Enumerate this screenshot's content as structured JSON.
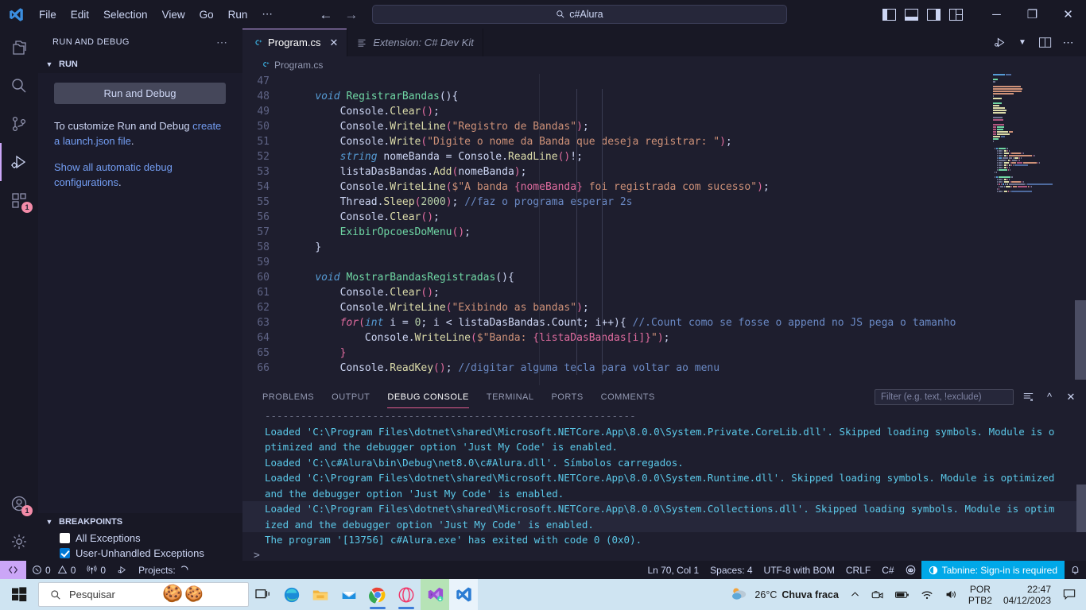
{
  "titlebar": {
    "menus": [
      "File",
      "Edit",
      "Selection",
      "View",
      "Go",
      "Run",
      "⋯"
    ],
    "search_value": "c#Alura",
    "back_icon": "arrow-left-icon",
    "forward_icon": "arrow-right-icon",
    "minimize": "─",
    "maximize": "❐",
    "close": "✕"
  },
  "activitybar": {
    "items": [
      {
        "name": "explorer",
        "badge": ""
      },
      {
        "name": "search",
        "badge": ""
      },
      {
        "name": "source-control",
        "badge": ""
      },
      {
        "name": "run-and-debug",
        "badge": ""
      },
      {
        "name": "extensions",
        "badge": "1"
      }
    ],
    "bottom": [
      {
        "name": "accounts",
        "badge": "1"
      },
      {
        "name": "manage-settings",
        "badge": ""
      }
    ]
  },
  "sidebar": {
    "title": "RUN AND DEBUG",
    "more_actions": "⋯",
    "run_section": {
      "label": "RUN",
      "button_label": "Run and Debug",
      "hint_prefix": "To customize Run and Debug ",
      "hint_link": "create a launch.json file",
      "hint_suffix": ".",
      "link2": "Show all automatic debug configurations",
      "link2_suffix": "."
    },
    "breakpoints": {
      "label": "BREAKPOINTS",
      "items": [
        {
          "label": "All Exceptions",
          "checked": false
        },
        {
          "label": "User-Unhandled Exceptions",
          "checked": true
        }
      ]
    }
  },
  "editor": {
    "tabs": [
      {
        "label": "Program.cs",
        "icon": "csharp-icon",
        "active": true,
        "italic": false,
        "close": "✕"
      },
      {
        "label": "Extension: C# Dev Kit",
        "icon": "extension-icon",
        "active": false,
        "italic": true,
        "close": ""
      }
    ],
    "toolbar": [
      "run-debug-icon",
      "chevron-down-icon",
      "split-editor-icon",
      "more-actions-icon"
    ],
    "breadcrumb": "Program.cs",
    "first_line_number": 47,
    "lines": [
      {
        "n": 47,
        "tokens": []
      },
      {
        "n": 48,
        "tokens": [
          {
            "t": "    ",
            "c": "c-plain"
          },
          {
            "t": "void ",
            "c": "c-kw"
          },
          {
            "t": "RegistrarBandas",
            "c": "c-fn"
          },
          {
            "t": "(){",
            "c": "c-plain"
          }
        ]
      },
      {
        "n": 49,
        "tokens": [
          {
            "t": "        ",
            "c": "c-plain"
          },
          {
            "t": "Console",
            "c": "c-plain"
          },
          {
            "t": ".",
            "c": "c-plain"
          },
          {
            "t": "Clear",
            "c": "c-meth"
          },
          {
            "t": "()",
            "c": "c-pun"
          },
          {
            "t": ";",
            "c": "c-plain"
          }
        ]
      },
      {
        "n": 50,
        "tokens": [
          {
            "t": "        ",
            "c": "c-plain"
          },
          {
            "t": "Console",
            "c": "c-plain"
          },
          {
            "t": ".",
            "c": "c-plain"
          },
          {
            "t": "WriteLine",
            "c": "c-meth"
          },
          {
            "t": "(",
            "c": "c-pun"
          },
          {
            "t": "\"Registro de Bandas\"",
            "c": "c-str"
          },
          {
            "t": ")",
            "c": "c-pun"
          },
          {
            "t": ";",
            "c": "c-plain"
          }
        ]
      },
      {
        "n": 51,
        "tokens": [
          {
            "t": "        ",
            "c": "c-plain"
          },
          {
            "t": "Console",
            "c": "c-plain"
          },
          {
            "t": ".",
            "c": "c-plain"
          },
          {
            "t": "Write",
            "c": "c-meth"
          },
          {
            "t": "(",
            "c": "c-pun"
          },
          {
            "t": "\"Digite o nome da Banda que deseja registrar: \"",
            "c": "c-str"
          },
          {
            "t": ")",
            "c": "c-pun"
          },
          {
            "t": ";",
            "c": "c-plain"
          }
        ]
      },
      {
        "n": 52,
        "tokens": [
          {
            "t": "        ",
            "c": "c-plain"
          },
          {
            "t": "string",
            "c": "c-kw"
          },
          {
            "t": " nomeBanda = ",
            "c": "c-plain"
          },
          {
            "t": "Console",
            "c": "c-plain"
          },
          {
            "t": ".",
            "c": "c-plain"
          },
          {
            "t": "ReadLine",
            "c": "c-meth"
          },
          {
            "t": "()",
            "c": "c-pun"
          },
          {
            "t": "!;",
            "c": "c-plain"
          }
        ]
      },
      {
        "n": 53,
        "tokens": [
          {
            "t": "        ",
            "c": "c-plain"
          },
          {
            "t": "listaDasBandas",
            "c": "c-plain"
          },
          {
            "t": ".",
            "c": "c-plain"
          },
          {
            "t": "Add",
            "c": "c-meth"
          },
          {
            "t": "(",
            "c": "c-pun"
          },
          {
            "t": "nomeBanda",
            "c": "c-plain"
          },
          {
            "t": ")",
            "c": "c-pun"
          },
          {
            "t": ";",
            "c": "c-plain"
          }
        ]
      },
      {
        "n": 54,
        "tokens": [
          {
            "t": "        ",
            "c": "c-plain"
          },
          {
            "t": "Console",
            "c": "c-plain"
          },
          {
            "t": ".",
            "c": "c-plain"
          },
          {
            "t": "WriteLine",
            "c": "c-meth"
          },
          {
            "t": "(",
            "c": "c-pun"
          },
          {
            "t": "$\"A banda ",
            "c": "c-str"
          },
          {
            "t": "{nomeBanda}",
            "c": "c-interp"
          },
          {
            "t": " foi registrada com sucesso\"",
            "c": "c-str"
          },
          {
            "t": ")",
            "c": "c-pun"
          },
          {
            "t": ";",
            "c": "c-plain"
          }
        ]
      },
      {
        "n": 55,
        "tokens": [
          {
            "t": "        ",
            "c": "c-plain"
          },
          {
            "t": "Thread",
            "c": "c-plain"
          },
          {
            "t": ".",
            "c": "c-plain"
          },
          {
            "t": "Sleep",
            "c": "c-meth"
          },
          {
            "t": "(",
            "c": "c-pun"
          },
          {
            "t": "2000",
            "c": "c-num"
          },
          {
            "t": ")",
            "c": "c-pun"
          },
          {
            "t": "; ",
            "c": "c-plain"
          },
          {
            "t": "//faz o programa esperar 2s",
            "c": "c-cmt"
          }
        ]
      },
      {
        "n": 56,
        "tokens": [
          {
            "t": "        ",
            "c": "c-plain"
          },
          {
            "t": "Console",
            "c": "c-plain"
          },
          {
            "t": ".",
            "c": "c-plain"
          },
          {
            "t": "Clear",
            "c": "c-meth"
          },
          {
            "t": "()",
            "c": "c-pun"
          },
          {
            "t": ";",
            "c": "c-plain"
          }
        ]
      },
      {
        "n": 57,
        "tokens": [
          {
            "t": "        ",
            "c": "c-plain"
          },
          {
            "t": "ExibirOpcoesDoMenu",
            "c": "c-fn"
          },
          {
            "t": "()",
            "c": "c-pun"
          },
          {
            "t": ";",
            "c": "c-plain"
          }
        ]
      },
      {
        "n": 58,
        "tokens": [
          {
            "t": "    ",
            "c": "c-plain"
          },
          {
            "t": "}",
            "c": "c-plain"
          }
        ]
      },
      {
        "n": 59,
        "tokens": []
      },
      {
        "n": 60,
        "tokens": [
          {
            "t": "    ",
            "c": "c-plain"
          },
          {
            "t": "void ",
            "c": "c-kw"
          },
          {
            "t": "MostrarBandasRegistradas",
            "c": "c-fn"
          },
          {
            "t": "(){",
            "c": "c-plain"
          }
        ]
      },
      {
        "n": 61,
        "tokens": [
          {
            "t": "        ",
            "c": "c-plain"
          },
          {
            "t": "Console",
            "c": "c-plain"
          },
          {
            "t": ".",
            "c": "c-plain"
          },
          {
            "t": "Clear",
            "c": "c-meth"
          },
          {
            "t": "()",
            "c": "c-pun"
          },
          {
            "t": ";",
            "c": "c-plain"
          }
        ]
      },
      {
        "n": 62,
        "tokens": [
          {
            "t": "        ",
            "c": "c-plain"
          },
          {
            "t": "Console",
            "c": "c-plain"
          },
          {
            "t": ".",
            "c": "c-plain"
          },
          {
            "t": "WriteLine",
            "c": "c-meth"
          },
          {
            "t": "(",
            "c": "c-pun"
          },
          {
            "t": "\"Exibindo as bandas\"",
            "c": "c-str"
          },
          {
            "t": ")",
            "c": "c-pun"
          },
          {
            "t": ";",
            "c": "c-plain"
          }
        ]
      },
      {
        "n": 63,
        "tokens": [
          {
            "t": "        ",
            "c": "c-plain"
          },
          {
            "t": "for",
            "c": "c-ctrl"
          },
          {
            "t": "(",
            "c": "c-pun"
          },
          {
            "t": "int",
            "c": "c-kw"
          },
          {
            "t": " i = ",
            "c": "c-plain"
          },
          {
            "t": "0",
            "c": "c-num"
          },
          {
            "t": "; i < listaDasBandas.Count; i++)",
            "c": "c-plain"
          },
          {
            "t": "{ ",
            "c": "c-plain"
          },
          {
            "t": "//.Count como se fosse o append no JS pega o tamanho",
            "c": "c-cmt"
          }
        ]
      },
      {
        "n": 64,
        "tokens": [
          {
            "t": "            ",
            "c": "c-plain"
          },
          {
            "t": "Console",
            "c": "c-plain"
          },
          {
            "t": ".",
            "c": "c-plain"
          },
          {
            "t": "WriteLine",
            "c": "c-meth"
          },
          {
            "t": "(",
            "c": "c-pun"
          },
          {
            "t": "$\"Banda: ",
            "c": "c-str"
          },
          {
            "t": "{listaDasBandas[i]}",
            "c": "c-interp"
          },
          {
            "t": "\"",
            "c": "c-str"
          },
          {
            "t": ")",
            "c": "c-pun"
          },
          {
            "t": ";",
            "c": "c-plain"
          }
        ]
      },
      {
        "n": 65,
        "tokens": [
          {
            "t": "        ",
            "c": "c-plain"
          },
          {
            "t": "}",
            "c": "c-pun"
          }
        ]
      },
      {
        "n": 66,
        "tokens": [
          {
            "t": "        ",
            "c": "c-plain"
          },
          {
            "t": "Console",
            "c": "c-plain"
          },
          {
            "t": ".",
            "c": "c-plain"
          },
          {
            "t": "ReadKey",
            "c": "c-meth"
          },
          {
            "t": "()",
            "c": "c-pun"
          },
          {
            "t": "; ",
            "c": "c-plain"
          },
          {
            "t": "//digitar alguma tecla para voltar ao menu",
            "c": "c-cmt"
          }
        ]
      }
    ]
  },
  "panel": {
    "tabs": [
      "PROBLEMS",
      "OUTPUT",
      "DEBUG CONSOLE",
      "TERMINAL",
      "PORTS",
      "COMMENTS"
    ],
    "active_tab": "DEBUG CONSOLE",
    "filter_placeholder": "Filter (e.g. text, !exclude)",
    "actions": [
      "clear-console-icon",
      "chevron-up-icon",
      "close-icon"
    ],
    "console_lines": [
      {
        "text": "--------------------------------------------------------------",
        "style": "dim",
        "highlight": false
      },
      {
        "text": "Loaded 'C:\\Program Files\\dotnet\\shared\\Microsoft.NETCore.App\\8.0.0\\System.Private.CoreLib.dll'. Skipped loading symbols. Module is o",
        "style": "",
        "highlight": false
      },
      {
        "text": "ptimized and the debugger option 'Just My Code' is enabled.",
        "style": "",
        "highlight": false
      },
      {
        "text": "Loaded 'C:\\c#Alura\\bin\\Debug\\net8.0\\c#Alura.dll'. Símbolos carregados.",
        "style": "",
        "highlight": false
      },
      {
        "text": "Loaded 'C:\\Program Files\\dotnet\\shared\\Microsoft.NETCore.App\\8.0.0\\System.Runtime.dll'. Skipped loading symbols. Module is optimized",
        "style": "",
        "highlight": false
      },
      {
        "text": "and the debugger option 'Just My Code' is enabled.",
        "style": "",
        "highlight": false
      },
      {
        "text": "Loaded 'C:\\Program Files\\dotnet\\shared\\Microsoft.NETCore.App\\8.0.0\\System.Collections.dll'. Skipped loading symbols. Module is optim",
        "style": "",
        "highlight": true
      },
      {
        "text": "ized and the debugger option 'Just My Code' is enabled.",
        "style": "",
        "highlight": true
      },
      {
        "text": "The program '[13756] c#Alura.exe' has exited with code 0 (0x0).",
        "style": "",
        "highlight": false
      }
    ],
    "prompt": ">"
  },
  "statusbar": {
    "remote_icon": "remote-window-icon",
    "errors": "0",
    "warnings": "0",
    "ports": "0",
    "debug_icon": "run-debug-icon",
    "projects_label": "Projects:",
    "projects_spinner": "loading-spinner",
    "position": "Ln 70, Col 1",
    "spaces": "Spaces: 4",
    "encoding": "UTF-8 with BOM",
    "eol": "CRLF",
    "language": "C#",
    "extra_icon": "copilot-icon",
    "tabnine": "Tabnine: Sign-in is required",
    "bell_icon": "notifications-icon"
  },
  "taskbar": {
    "start": "windows-start-icon",
    "search_placeholder": "Pesquisar",
    "search_icon": "search-icon",
    "decor_icons": [
      "gingerbread-icon",
      "cookie-icon"
    ],
    "apps": [
      {
        "name": "task-view-icon",
        "state": ""
      },
      {
        "name": "microsoft-edge-icon",
        "state": ""
      },
      {
        "name": "file-explorer-icon",
        "state": ""
      },
      {
        "name": "mail-icon",
        "state": ""
      },
      {
        "name": "google-chrome-icon",
        "state": "running"
      },
      {
        "name": "opera-icon",
        "state": "running"
      },
      {
        "name": "visual-studio-icon",
        "state": "active-green"
      },
      {
        "name": "vscode-icon",
        "state": "active-white"
      }
    ],
    "weather": {
      "temp": "26°C",
      "condition": "Chuva fraca",
      "icon": "rain-cloud-icon"
    },
    "tray_icons": [
      "chevron-up-icon",
      "meet-now-icon",
      "battery-icon",
      "wifi-icon",
      "volume-icon"
    ],
    "language": {
      "line1": "POR",
      "line2": "PTB2"
    },
    "clock": {
      "time": "22:47",
      "date": "04/12/2023"
    },
    "notification_icon": "notification-center-icon"
  },
  "colors": {
    "accent": "#cba6f7",
    "tabnine": "#00a8e8",
    "badge": "#f38ba8",
    "panel_active": "#e05c8f",
    "console_text": "#5bc8e8"
  }
}
